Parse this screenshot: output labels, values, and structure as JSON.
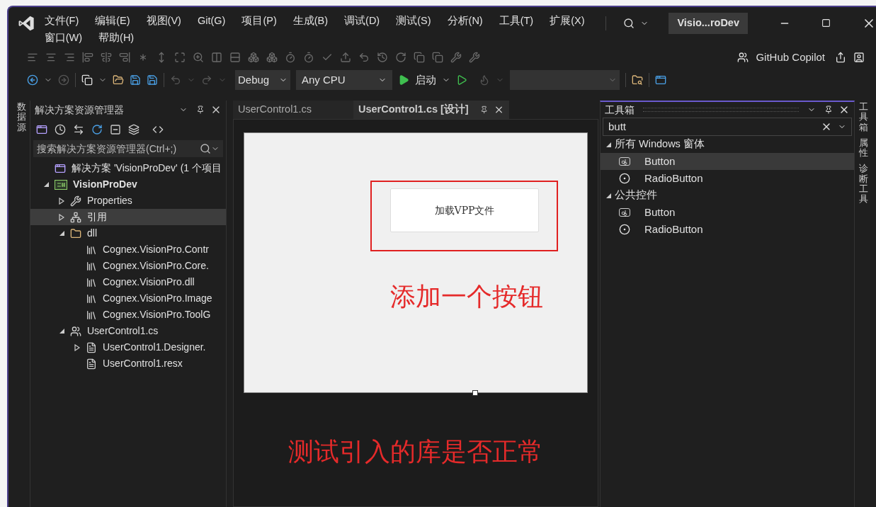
{
  "menu": [
    {
      "label": "文件(F)"
    },
    {
      "label": "编辑(E)"
    },
    {
      "label": "视图(V)"
    },
    {
      "label": "Git(G)"
    },
    {
      "label": "项目(P)"
    },
    {
      "label": "生成(B)"
    },
    {
      "label": "调试(D)"
    },
    {
      "label": "测试(S)"
    },
    {
      "label": "分析(N)"
    },
    {
      "label": "工具(T)"
    },
    {
      "label": "扩展(X)"
    },
    {
      "label": "窗口(W)"
    },
    {
      "label": "帮助(H)"
    }
  ],
  "title_badge": "Visio...roDev",
  "toolbar": {
    "configuration": "Debug",
    "platform": "Any CPU",
    "start_label": "启动",
    "copilot_label": "GitHub Copilot"
  },
  "left_tabs": [
    {
      "label": "数据源"
    }
  ],
  "solution_explorer": {
    "title": "解决方案资源管理器",
    "search": {
      "placeholder": "搜索解决方案资源管理器(Ctrl+;)"
    },
    "tree": [
      {
        "label": "解决方案 'VisionProDev' (1 个项目",
        "kind": "solution",
        "selected": false
      },
      {
        "label": "VisionProDev",
        "kind": "project",
        "expanded": true,
        "selected": false,
        "children": [
          {
            "label": "Properties",
            "kind": "properties",
            "expanded": false,
            "selected": false
          },
          {
            "label": "引用",
            "kind": "references",
            "expanded": false,
            "selected": true
          },
          {
            "label": "dll",
            "kind": "folder",
            "expanded": true,
            "selected": false,
            "children": [
              {
                "label": "Cognex.VisionPro.Contr",
                "kind": "library",
                "selected": false
              },
              {
                "label": "Cognex.VisionPro.Core.",
                "kind": "library",
                "selected": false
              },
              {
                "label": "Cognex.VisionPro.dll",
                "kind": "library",
                "selected": false
              },
              {
                "label": "Cognex.VisionPro.Image",
                "kind": "library",
                "selected": false
              },
              {
                "label": "Cognex.VisionPro.ToolG",
                "kind": "library",
                "selected": false
              }
            ]
          },
          {
            "label": "UserControl1.cs",
            "kind": "control",
            "expanded": true,
            "selected": false,
            "children": [
              {
                "label": "UserControl1.Designer.",
                "kind": "file",
                "expanded": false,
                "selected": false
              },
              {
                "label": "UserControl1.resx",
                "kind": "file",
                "selected": false
              }
            ]
          }
        ]
      }
    ]
  },
  "editor": {
    "tabs": [
      {
        "label": "UserControl1.cs",
        "selected": false
      },
      {
        "label": "UserControl1.cs [设计]",
        "selected": true
      }
    ],
    "form_button": "加载VPP文件",
    "notes": [
      {
        "text": "添加一个按钮"
      },
      {
        "text": "测试引入的库是否正常"
      }
    ]
  },
  "toolbox": {
    "title": "工具箱",
    "search": {
      "value": "butt"
    },
    "groups": [
      {
        "label": "所有 Windows 窗体",
        "expanded": true,
        "items": [
          {
            "label": "Button",
            "kind": "button",
            "selected": true
          },
          {
            "label": "RadioButton",
            "kind": "radio",
            "selected": false
          }
        ]
      },
      {
        "label": "公共控件",
        "expanded": true,
        "items": [
          {
            "label": "Button",
            "kind": "button",
            "selected": false
          },
          {
            "label": "RadioButton",
            "kind": "radio",
            "selected": false
          }
        ]
      }
    ]
  },
  "right_tabs": [
    {
      "label": "工具箱"
    },
    {
      "label": "属性"
    },
    {
      "label": "诊断工具"
    }
  ]
}
